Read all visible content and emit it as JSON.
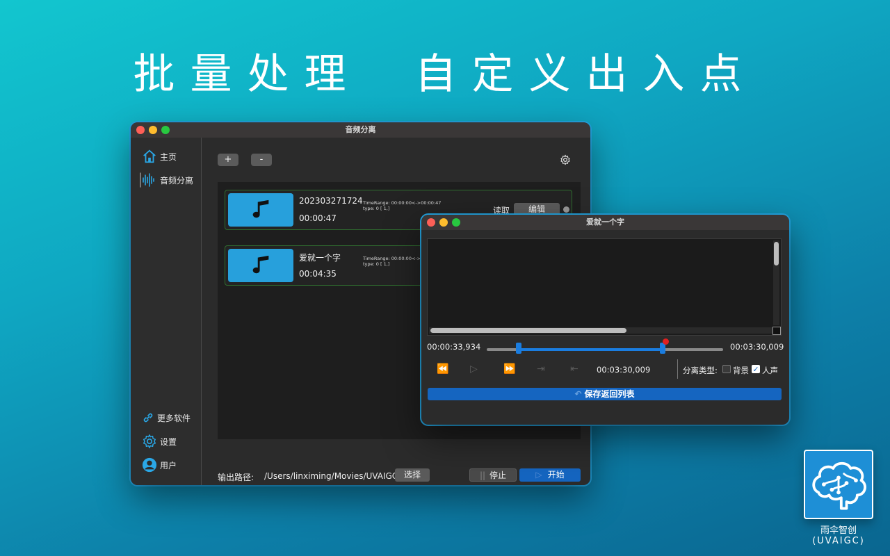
{
  "headline": {
    "part1": "批量处理",
    "part2": "自定义出入点"
  },
  "main_window": {
    "title": "音频分离",
    "sidebar": {
      "items": [
        {
          "label": "主页",
          "icon": "home-icon"
        },
        {
          "label": "音频分离",
          "icon": "waveform-icon"
        }
      ],
      "bottom_items": [
        {
          "label": "更多软件",
          "icon": "link-icon"
        },
        {
          "label": "设置",
          "icon": "gear-icon"
        },
        {
          "label": "用户",
          "icon": "user-icon"
        }
      ]
    },
    "toolbar": {
      "add_label": "+",
      "remove_label": "-"
    },
    "files": [
      {
        "name": "202303271724",
        "duration": "00:00:47",
        "time_range": "TimeRange: 00:00:00<->00:00:47",
        "type": "type: 0 [ 1,]",
        "read_label": "读取",
        "edit_label": "编辑"
      },
      {
        "name": "爱就一个字",
        "duration": "00:04:35",
        "time_range": "TimeRange: 00:00:00<->",
        "type": "type: 0 [ 1,]"
      }
    ],
    "footer": {
      "output_label": "输出路径:",
      "output_path": "/Users/linximing/Movies/UVAIGC",
      "choose_label": "选择",
      "stop_label": "停止",
      "start_label": "开始"
    }
  },
  "editor_window": {
    "title": "爱就一个字",
    "start_time": "00:00:33,934",
    "end_time": "00:03:30,009",
    "current_time": "00:03:30,009",
    "range": {
      "start_fraction": 0.135,
      "end_fraction": 0.745,
      "playhead_fraction": 0.755
    },
    "separation_label": "分离类型:",
    "options": [
      {
        "label": "背景",
        "checked": false
      },
      {
        "label": "人声",
        "checked": true
      }
    ],
    "save_label": "保存返回列表"
  },
  "brand": {
    "name": "雨伞智创",
    "sub": "(UVAIGC)"
  },
  "colors": {
    "accent": "#1565c0",
    "thumb": "#27a0dc",
    "window_border": "#23a4e0"
  }
}
